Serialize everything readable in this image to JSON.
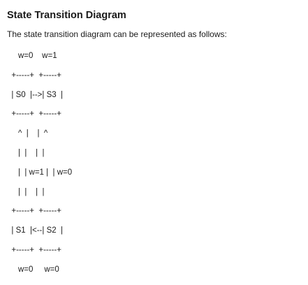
{
  "document": {
    "title": "State Transition Diagram",
    "intro": "The state transition diagram can be represented as follows:",
    "diagram_lines": [
      "     w=0    w=1",
      "  +-----+  +-----+",
      "  | S0  |-->| S3  |",
      "  +-----+  +-----+",
      "     ^  |    |  ^",
      "     |  |    |  |",
      "     |  | w=1 |  | w=0",
      "     |  |    |  |",
      "  +-----+  +-----+",
      "  | S1  |<--| S2  |",
      "  +-----+  +-----+",
      "     w=0     w=0"
    ]
  }
}
